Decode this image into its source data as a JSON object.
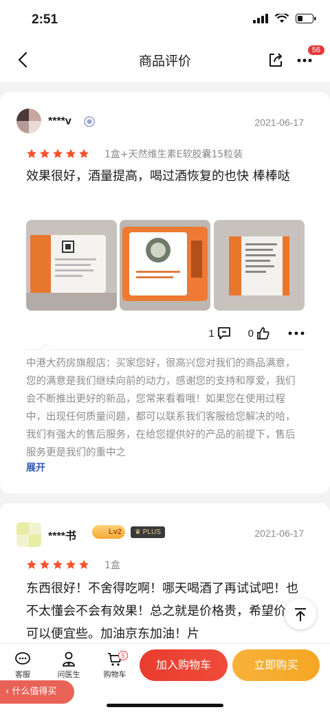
{
  "status_bar": {
    "time": "2:51"
  },
  "nav": {
    "title": "商品评价",
    "badge": "56"
  },
  "reviews": [
    {
      "username": "****v",
      "date": "2021-06-17",
      "rating": 5,
      "spec": "1盒+天然维生素E软胶囊15粒装",
      "text": "效果很好，酒量提高，喝过酒恢复的也快 棒棒哒",
      "likes_comments": "1",
      "likes": "0",
      "reply_text": "中港大药房旗舰店：买家您好，很高兴您对我们的商品满意，您的满意是我们继续向前的动力，感谢您的支持和厚爱，我们会不断推出更好的新品，您常来看看哦！如果您在使用过程中，出现任何质量问题，都可以联系我们客服给您解决的哈，我们有强大的售后服务，在给您提供好的产品的前提下，售后服务更是我们的重中之",
      "expand_label": "展开"
    },
    {
      "username": "****书",
      "badge_level": "Lv2",
      "badge_plus": "PLUS",
      "date": "2021-06-17",
      "rating": 5,
      "spec": "1盒",
      "text": "东西很好！不舍得吃啊！哪天喝酒了再试试吧！也不太懂会不会有效果！总之就是价格贵，希望价格可以便宜些。加油京东加油！片"
    }
  ],
  "bottom_bar": {
    "service_label": "客服",
    "doctor_label": "问医生",
    "cart_label": "购物车",
    "cart_count": "5",
    "add_cart_label": "加入购物车",
    "buy_now_label": "立即购买"
  },
  "worth_buying_label": "什么值得买",
  "colors": {
    "accent_red": "#e4393c",
    "star_orange": "#f5532d",
    "buy_orange": "#f5a623",
    "link_blue": "#2a5bb5"
  }
}
